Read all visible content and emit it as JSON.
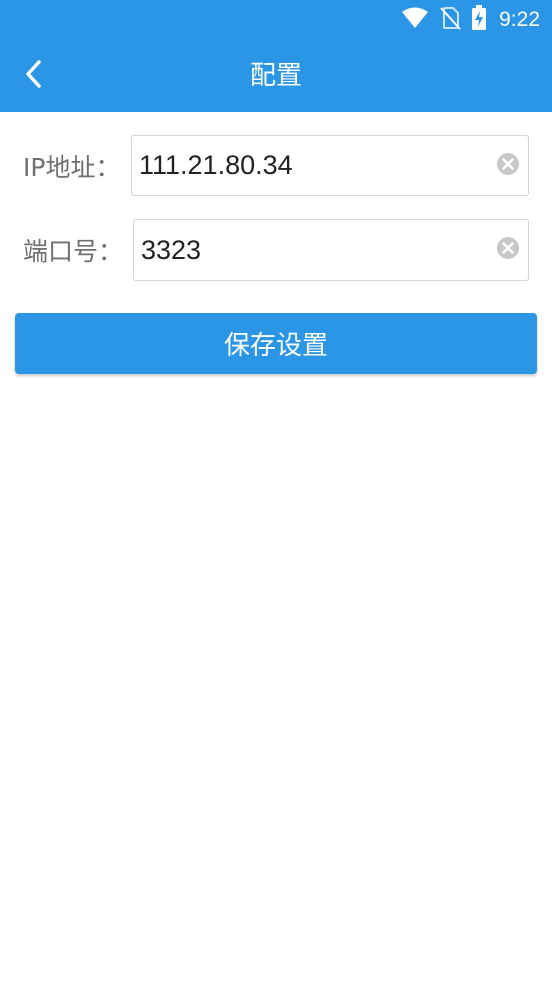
{
  "status_bar": {
    "time": "9:22",
    "icons": [
      "wifi-icon",
      "no-sim-icon",
      "battery-charging-icon"
    ]
  },
  "app_bar": {
    "title": "配置",
    "back_icon": "chevron-left-icon"
  },
  "form": {
    "ip": {
      "label": "IP地址：",
      "value": "111.21.80.34",
      "clear_icon": "clear-circle-icon"
    },
    "port": {
      "label": "端口号：",
      "value": "3323",
      "clear_icon": "clear-circle-icon"
    }
  },
  "save_button": {
    "label": "保存设置"
  },
  "colors": {
    "primary": "#2b95e6",
    "label_text": "#6f6f6f",
    "input_text": "#222222",
    "input_border": "#d4d4d4",
    "clear_icon": "#c8c8c8"
  }
}
